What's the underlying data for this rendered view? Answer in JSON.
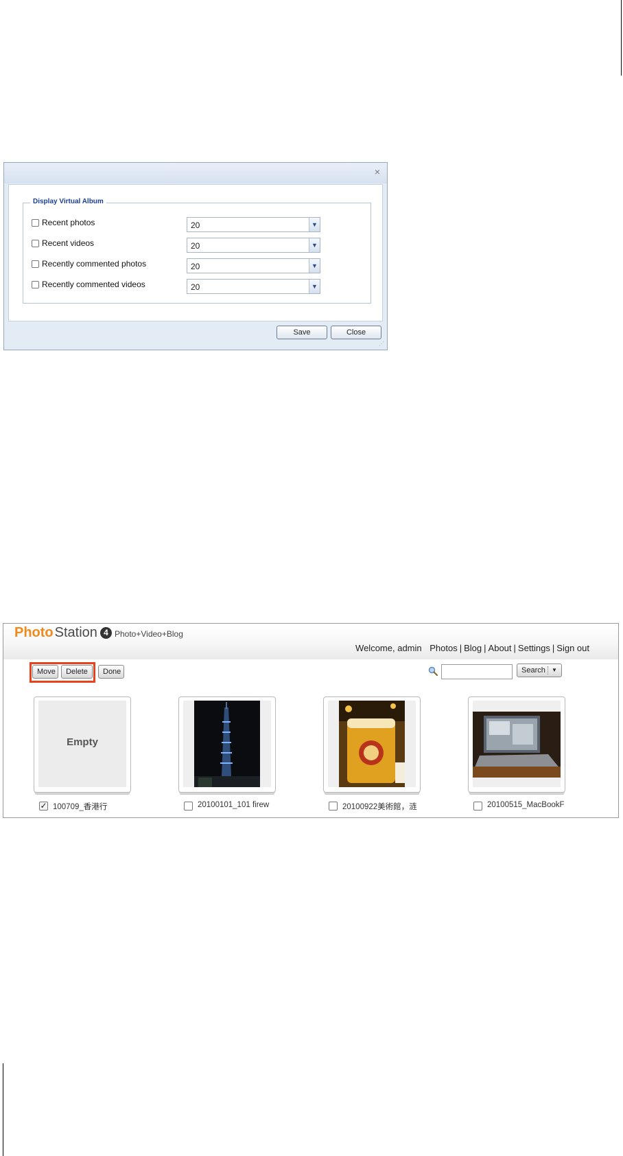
{
  "settings_dialog": {
    "close_glyph": "×",
    "legend": "Display Virtual Album",
    "options": [
      {
        "label": "Recent photos",
        "checked": false,
        "value": "20"
      },
      {
        "label": "Recent videos",
        "checked": false,
        "value": "20"
      },
      {
        "label": "Recently commented photos",
        "checked": false,
        "value": "20"
      },
      {
        "label": "Recently commented videos",
        "checked": false,
        "value": "20"
      }
    ],
    "save_label": "Save",
    "close_label": "Close"
  },
  "photo_station": {
    "logo": {
      "word1": "Photo",
      "word2": "Station",
      "version": "4",
      "tagline": "Photo+Video+Blog"
    },
    "nav": {
      "welcome": "Welcome, admin",
      "links": [
        "Photos",
        "Blog",
        "About",
        "Settings",
        "Sign out"
      ]
    },
    "toolbar": {
      "move_label": "Move",
      "delete_label": "Delete",
      "done_label": "Done"
    },
    "search": {
      "placeholder": "",
      "button_label": "Search"
    },
    "albums": [
      {
        "name": "100709_香港行",
        "checked": true,
        "thumb": "empty",
        "empty_text": "Empty"
      },
      {
        "name": "20100101_101 firew",
        "checked": false,
        "thumb": "night-tower"
      },
      {
        "name": "20100922美術館，涟",
        "checked": false,
        "thumb": "beer-glass"
      },
      {
        "name": "20100515_MacBookF",
        "checked": false,
        "thumb": "laptop"
      }
    ],
    "colors": {
      "logo_orange": "#f08a1c",
      "highlight_red": "#e8421c"
    }
  }
}
